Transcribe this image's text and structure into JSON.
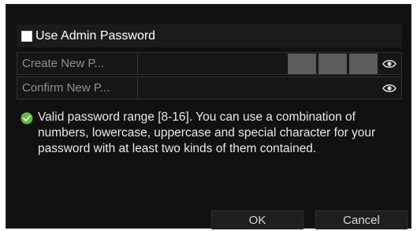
{
  "admin_password": {
    "label": "Use Admin Password",
    "checked": false
  },
  "fields": {
    "create": {
      "label": "Create New P...",
      "value": ""
    },
    "confirm": {
      "label": "Confirm New P...",
      "value": ""
    }
  },
  "info": {
    "icon": "check-circle-icon",
    "text": "Valid password range [8-16]. You can use a combination of numbers, lowercase, uppercase and special character for your password with at least two kinds of them contained."
  },
  "buttons": {
    "ok": "OK",
    "cancel": "Cancel"
  },
  "colors": {
    "background": "#111111",
    "accent_green": "#5bbf3a",
    "strength_bar": "#5c5c5c"
  }
}
